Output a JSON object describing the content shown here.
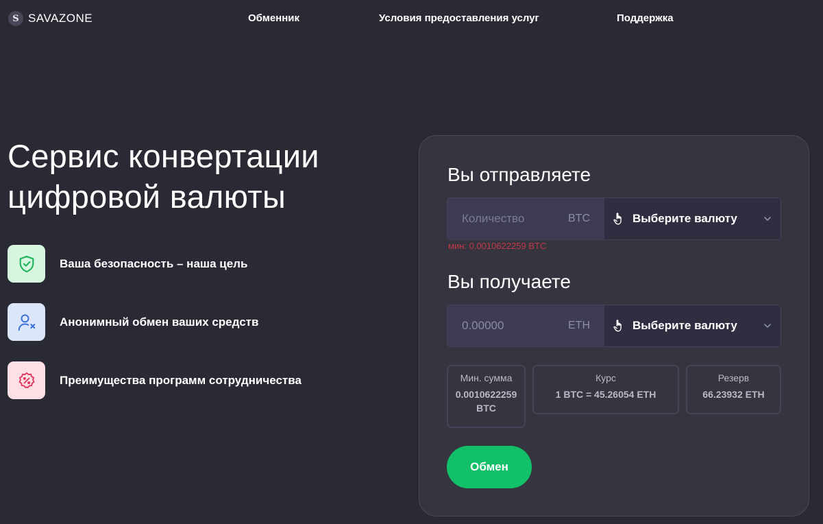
{
  "header": {
    "logo_letter": "S",
    "logo_text": "SAVAZONE",
    "nav": [
      "Обменник",
      "Условия предоставления услуг",
      "Поддержка"
    ]
  },
  "hero": {
    "title_line1": "Сервис конвертации",
    "title_line2": "цифровой валюты",
    "features": [
      {
        "icon": "shield-check-icon",
        "text": "Ваша безопасность – наша цель",
        "bg": "#d6f6df",
        "color": "#1fb35a"
      },
      {
        "icon": "user-x-icon",
        "text": "Анонимный обмен ваших средств",
        "bg": "#dbe6fb",
        "color": "#3c6fd8"
      },
      {
        "icon": "discount-badge-icon",
        "text": "Преимущества программ сотрудничества",
        "bg": "#fde0e6",
        "color": "#e0365d"
      }
    ]
  },
  "exchange": {
    "send": {
      "title": "Вы отправляете",
      "placeholder": "Количество",
      "value": "",
      "currency": "BTC",
      "select_label": "Выберите валюту",
      "min_hint": "мин: 0.0010622259 BTC"
    },
    "receive": {
      "title": "Вы получаете",
      "value": "0.00000",
      "currency": "ETH",
      "select_label": "Выберите валюту"
    },
    "stats": [
      {
        "label": "Мин. сумма",
        "value_line1": "0.0010622259",
        "value_line2": "BTC"
      },
      {
        "label": "Курс",
        "value_line1": "1 BTC = 45.26054 ETH"
      },
      {
        "label": "Резерв",
        "value_line1": "66.23932 ETH"
      }
    ],
    "button_label": "Обмен"
  },
  "colors": {
    "background": "#2a2a35",
    "card": "#35343f",
    "accent": "#12c06a",
    "error": "#c03a48"
  }
}
